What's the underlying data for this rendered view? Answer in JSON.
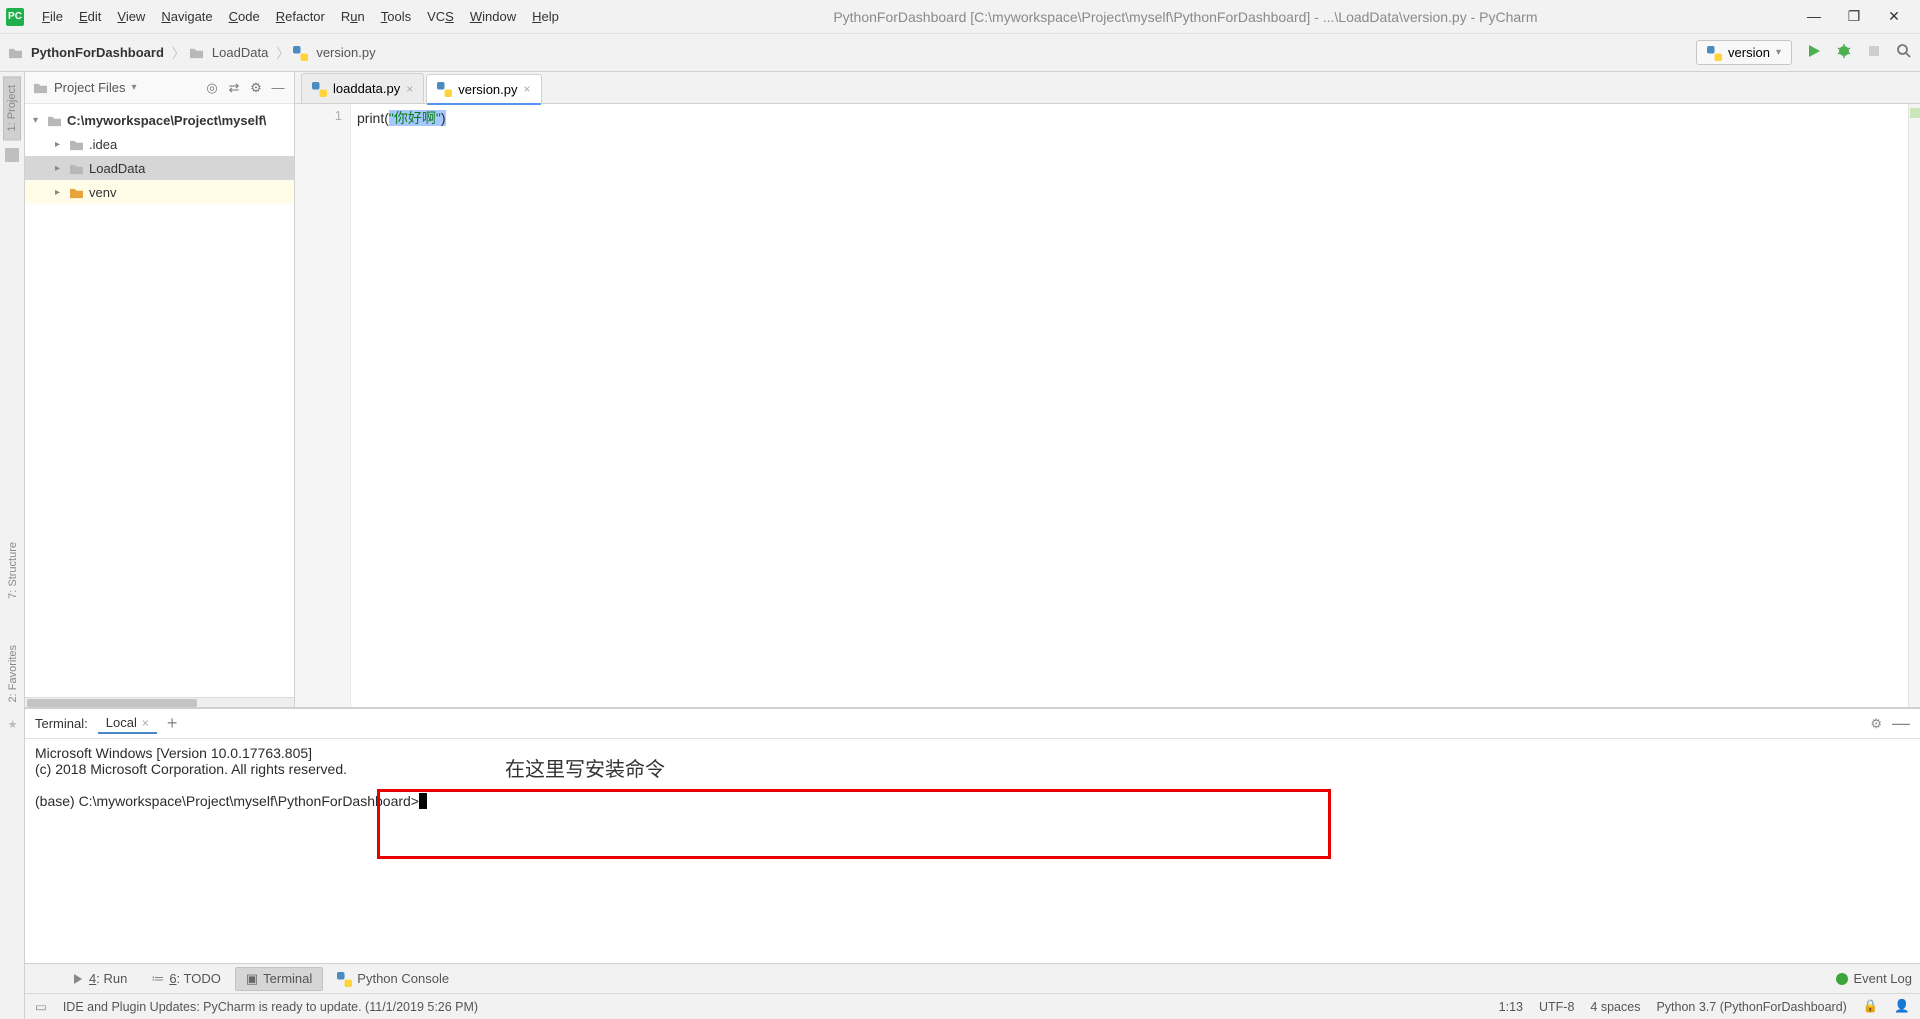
{
  "menu": {
    "items": [
      "File",
      "Edit",
      "View",
      "Navigate",
      "Code",
      "Refactor",
      "Run",
      "Tools",
      "VCS",
      "Window",
      "Help"
    ]
  },
  "window_title": "PythonForDashboard [C:\\myworkspace\\Project\\myself\\PythonForDashboard] - ...\\LoadData\\version.py - PyCharm",
  "breadcrumb": {
    "c1": "PythonForDashboard",
    "c2": "LoadData",
    "c3": "version.py"
  },
  "run_config": {
    "label": "version"
  },
  "left_gutter": {
    "project": "1: Project"
  },
  "project_header": {
    "label": "Project Files"
  },
  "tree": {
    "root": "C:\\myworkspace\\Project\\myself\\",
    "n1": ".idea",
    "n2": "LoadData",
    "n3": "venv"
  },
  "tabs": {
    "t1": "loaddata.py",
    "t2": "version.py"
  },
  "code": {
    "line_no": "1",
    "fn": "print",
    "str": "\"你好啊\""
  },
  "terminal": {
    "label": "Terminal:",
    "tab": "Local",
    "line1": "Microsoft Windows [Version 10.0.17763.805]",
    "line2": "(c) 2018 Microsoft Corporation. All rights reserved.",
    "prompt": "(base) C:\\myworkspace\\Project\\myself\\PythonForDashboard>",
    "annotation": "在这里写安装命令"
  },
  "tool_strip": {
    "run": "4: Run",
    "todo": "6: TODO",
    "terminal": "Terminal",
    "pyconsole": "Python Console",
    "event_log": "Event Log"
  },
  "status": {
    "msg": "IDE and Plugin Updates: PyCharm is ready to update. (11/1/2019 5:26 PM)",
    "pos": "1:13",
    "enc": "UTF-8",
    "indent": "4 spaces",
    "interp": "Python 3.7 (PythonForDashboard)"
  },
  "side_tabs": {
    "structure": "7: Structure",
    "favorites": "2: Favorites"
  }
}
